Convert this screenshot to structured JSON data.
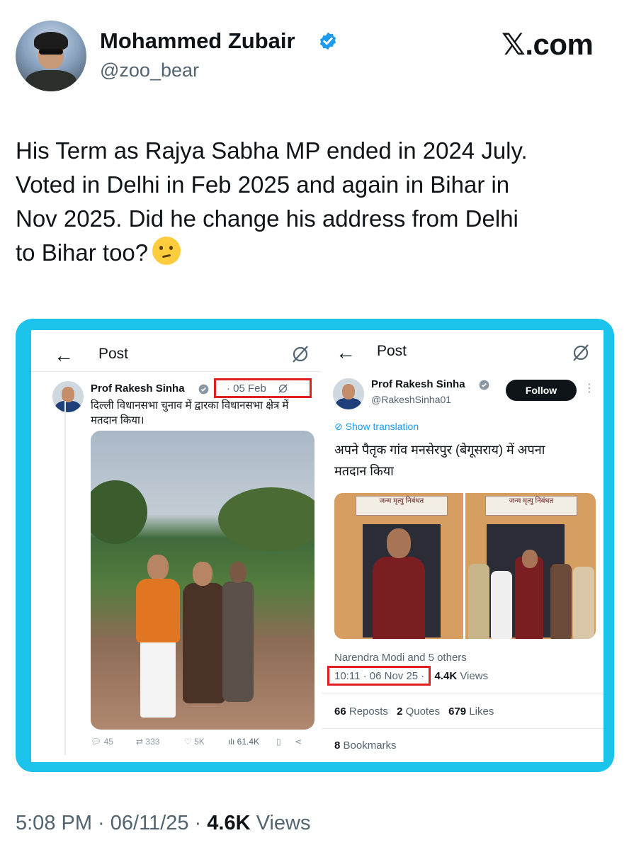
{
  "author": {
    "name": "Mohammed Zubair",
    "handle": "@zoo_bear",
    "verified": true
  },
  "brand": "𝕏.com",
  "tweet": {
    "lines": [
      "His Term as Rajya Sabha MP ended in 2024 July.",
      "Voted in Delhi in Feb 2025 and again in Bihar in",
      "Nov 2025. Did he change his address from Delhi",
      "to Bihar too?"
    ],
    "emoji": "thinking-face"
  },
  "left_card": {
    "header_title": "Post",
    "name": "Prof Rakesh Sinha",
    "date": "· 05 Feb",
    "text_line1": "दिल्ली विधानसभा चुनाव में द्वारका विधानसभा क्षेत्र में",
    "text_line2": "मतदान किया।",
    "actions": {
      "replies": "45",
      "reposts": "333",
      "likes": "5K",
      "views": "61.4K"
    }
  },
  "right_card": {
    "header_title": "Post",
    "name": "Prof Rakesh Sinha",
    "handle": "@RakeshSinha01",
    "follow_label": "Follow",
    "show_translation": "Show translation",
    "text_line1": "अपने पैतृक गांव मनसेरपुर (बेगूसराय) में अपना",
    "text_line2": "मतदान किया",
    "photo_sign": "जन्म मृत्यु निबंधत",
    "liked_by": "Narendra Modi and 5 others",
    "timestamp": "10:11 · 06 Nov 25 ·",
    "views_count": "4.4K",
    "views_label": "Views",
    "reposts_count": "66",
    "reposts_label": "Reposts",
    "quotes_count": "2",
    "quotes_label": "Quotes",
    "likes_count": "679",
    "likes_label": "Likes",
    "bookmarks_count": "8",
    "bookmarks_label": "Bookmarks"
  },
  "footer": {
    "time": "5:08 PM · 06/11/25 ·",
    "views_count": "4.6K",
    "views_label": "Views"
  },
  "colors": {
    "frame": "#1cc4ec",
    "highlight": "#e02020",
    "link": "#1d9bf0",
    "verified": "#1d9bf0"
  }
}
